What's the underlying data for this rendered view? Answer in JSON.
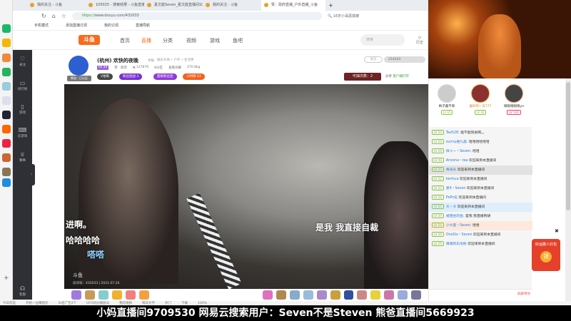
{
  "browser": {
    "tabs": [
      "我的关注 - 斗鱼",
      "105025 - 搜索结果 - 斗鱼直播",
      "夏文庭Seven_夏文庭直播间105025",
      "我的关注 - 斗鱼",
      "赞：政府直播_户外直播_斗鱼"
    ],
    "url_scheme": "https://",
    "url": "www.douyu.com/432033",
    "search": "16岁小哥恶搞被",
    "bookmarks": [
      "手机模式",
      "添加直播订阅",
      "我的订阅",
      "直播导航"
    ]
  },
  "douyu": {
    "logo": "斗鱼",
    "menu": [
      "首页",
      "直播",
      "分类",
      "视频",
      "游戏",
      "鱼吧"
    ],
    "search_placeholder": "搜索",
    "history": "历史"
  },
  "sidebar": [
    "关注",
    "排行榜",
    "游戏",
    "云游戏",
    "赛事",
    "客服"
  ],
  "room": {
    "avatar_tag": "熊爸 · 已认证",
    "title": "(杭州) 欢快的夜晚",
    "report": "举报",
    "category": "娱乐天地 • 户外 • 生活秀",
    "level": "LV 34",
    "stats": [
      "赞 · 政府",
      "127876",
      "8分区",
      "查看闭幕",
      "270.8kg"
    ],
    "badges": [
      "V拍照",
      "粉丝团战 3",
      "超级粉丝团",
      "小时榜 43"
    ],
    "follow": "关注",
    "fans": "214243",
    "lottery": "可抽次数：2",
    "share": "分享",
    "client": "客户端打开"
  },
  "video": {
    "subtitles": [
      "进啊。",
      "哈哈哈哈",
      "嗒嗒",
      "是我  我直接自裁"
    ],
    "watermark": "斗鱼",
    "room_no": "房间号：432033 | 2021.07.26"
  },
  "chat": {
    "top3": [
      {
        "name": "梅子酱不够",
        "lv": "LV 65"
      },
      {
        "name": "喜好的一天777",
        "lv": "LV 36"
      },
      {
        "name": "眼眼眼眼眼yo",
        "lv": "LV 120"
      }
    ],
    "messages": [
      {
        "lv": "LV 34",
        "name": "Tao528:",
        "text": "能不能快进啊。。",
        "style": ""
      },
      {
        "lv": "LV 24",
        "name": "sunny君九森:",
        "text": "哈哈哈哈哈哈",
        "style": ""
      },
      {
        "lv": "LV 29",
        "name": "抹十一丶Seven:",
        "text": "哈哈",
        "style": ""
      },
      {
        "lv": "LV 40",
        "name": "Arizona丶tea",
        "text": "欢迎来到本直播间",
        "style": ""
      },
      {
        "lv": "LV 37",
        "name": "禹采乐",
        "text": "欢迎来到本直播间",
        "style": "hl"
      },
      {
        "lv": "LV 32",
        "name": "kenhua",
        "text": "欢迎来到本直播间",
        "style": ""
      },
      {
        "lv": "LV 32",
        "name": "墨4丶Seven",
        "text": "欢迎来到本直播间",
        "style": ""
      },
      {
        "lv": "LV 24",
        "name": "PoPo伍",
        "text": "欢迎来到本直播间",
        "style": ""
      },
      {
        "lv": "LV 65",
        "name": "大丶大",
        "text": "欢迎来到本直播间",
        "style": "blue"
      },
      {
        "lv": "LV 30",
        "name": "被困住的鱼:",
        "text": "是我 我直播例胡",
        "style": ""
      },
      {
        "lv": "LV 54",
        "name": "小大宽丶Seven:",
        "text": "哈哈",
        "style": "org"
      },
      {
        "lv": "LV 36",
        "name": "OneSix丶Seven",
        "text": "欢迎来到本直播间",
        "style": ""
      },
      {
        "lv": "LV 29",
        "name": "嗅嗅的白毛粉",
        "text": "欢迎来到本直播间",
        "style": ""
      }
    ],
    "input_hint": "屏蔽特效"
  },
  "redpack": {
    "title": "好运撒人红包",
    "label": "领"
  },
  "statusbar": [
    "今日优选",
    "开始一边赚钱买",
    "iG名广告2个",
    "UFO同分播放法",
    "我的视频",
    "每日文字",
    "热门",
    "下载",
    "100%"
  ],
  "banner": "小妈直播间9709530  网易云搜索用户：Seven不是Steven 熊爸直播间5669923"
}
